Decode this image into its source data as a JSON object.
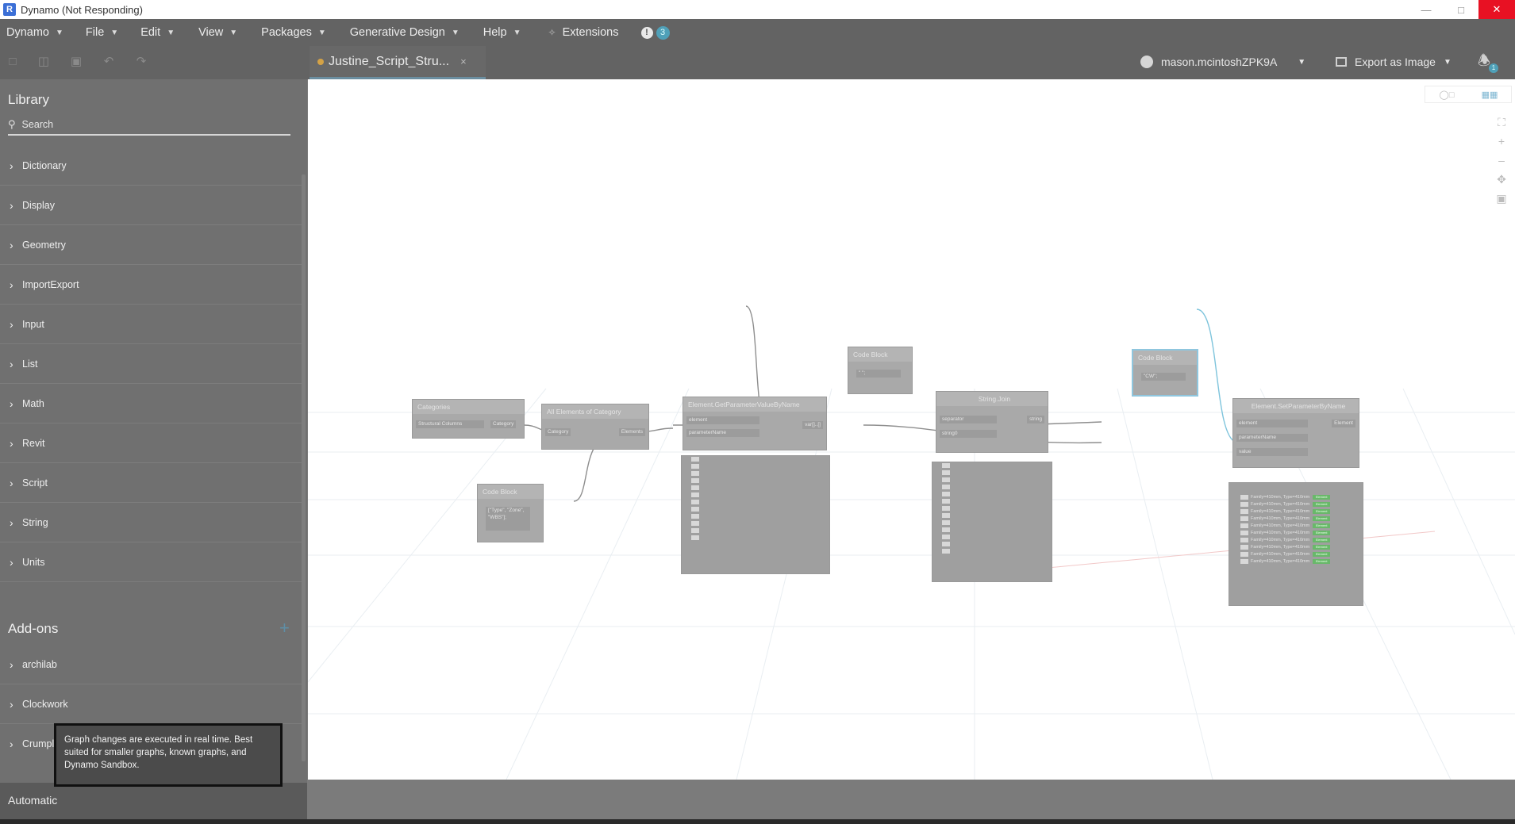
{
  "window": {
    "title": "Dynamo (Not Responding)",
    "app_icon": "R",
    "controls": [
      "minimize-icon",
      "maximize-icon",
      "close-icon"
    ]
  },
  "menu": {
    "items": [
      {
        "label": "Dynamo"
      },
      {
        "label": "File"
      },
      {
        "label": "Edit"
      },
      {
        "label": "View"
      },
      {
        "label": "Packages"
      },
      {
        "label": "Generative Design"
      },
      {
        "label": "Help"
      }
    ],
    "extensions_label": "Extensions",
    "notification_count": "3"
  },
  "toolbar": {
    "tab_title": "Justine_Script_Stru...",
    "tab_close": "×",
    "user_name": "mason.mcintoshZPK9A",
    "export_label": "Export as Image",
    "bell_count": "1"
  },
  "library": {
    "title": "Library",
    "search_placeholder": "Search",
    "categories": [
      "Dictionary",
      "Display",
      "Geometry",
      "ImportExport",
      "Input",
      "List",
      "Math",
      "Revit",
      "Script",
      "String",
      "Units"
    ],
    "addons_title": "Add-ons",
    "addons": [
      "archilab",
      "Clockwork",
      "Crumple"
    ],
    "run_label": "Automatic"
  },
  "tooltip": {
    "text": "Graph changes are executed in real time. Best suited for smaller graphs, known graphs, and Dynamo Sandbox."
  },
  "nodes": {
    "categories": {
      "title": "Categories",
      "value": "Structural Columns",
      "out": "Category"
    },
    "all_elements": {
      "title": "All Elements of Category",
      "in": "Category",
      "out": "Elements"
    },
    "get_param": {
      "title": "Element.GetParameterValueByName",
      "in1": "element",
      "in2": "parameterName",
      "out": "var[]..[]"
    },
    "code_block_1": {
      "title": "Code Block",
      "code": "[\"Type\", \"Zone\", \"WBS\"];"
    },
    "code_block_2": {
      "title": "Code Block",
      "code": "\" \";"
    },
    "string_join": {
      "title": "String.Join",
      "in1": "separator",
      "in2": "string0",
      "out": "string"
    },
    "code_block_3": {
      "title": "Code Block",
      "code": "\"CW\";"
    },
    "set_param": {
      "title": "Element.SetParameterByName",
      "in1": "element",
      "in2": "parameterName",
      "in3": "value",
      "out": "Element"
    },
    "preview_row": "Family=410mm, Type=410mm",
    "preview_tag": "Element"
  }
}
